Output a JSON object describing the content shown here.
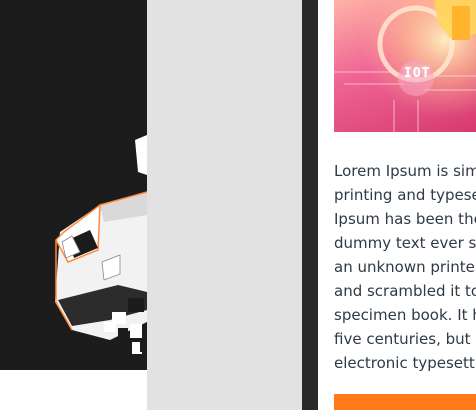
{
  "hero": {
    "label": "IOT",
    "icon": "iot-chip-icon"
  },
  "article": {
    "lines": [
      "Lorem Ipsum is sim",
      "printing and typese",
      "Ipsum has been the",
      "dummy text ever si",
      "an unknown printer",
      "and scrambled it to",
      "specimen book. It h",
      "five centuries, but a",
      "electronic typesett"
    ]
  },
  "colors": {
    "left_panel": "#1c1c1c",
    "divider_gray": "#e2e2e2",
    "divider_dark": "#2a2a2a",
    "accent": "#ff7a1a",
    "text": "#2f3a45"
  }
}
